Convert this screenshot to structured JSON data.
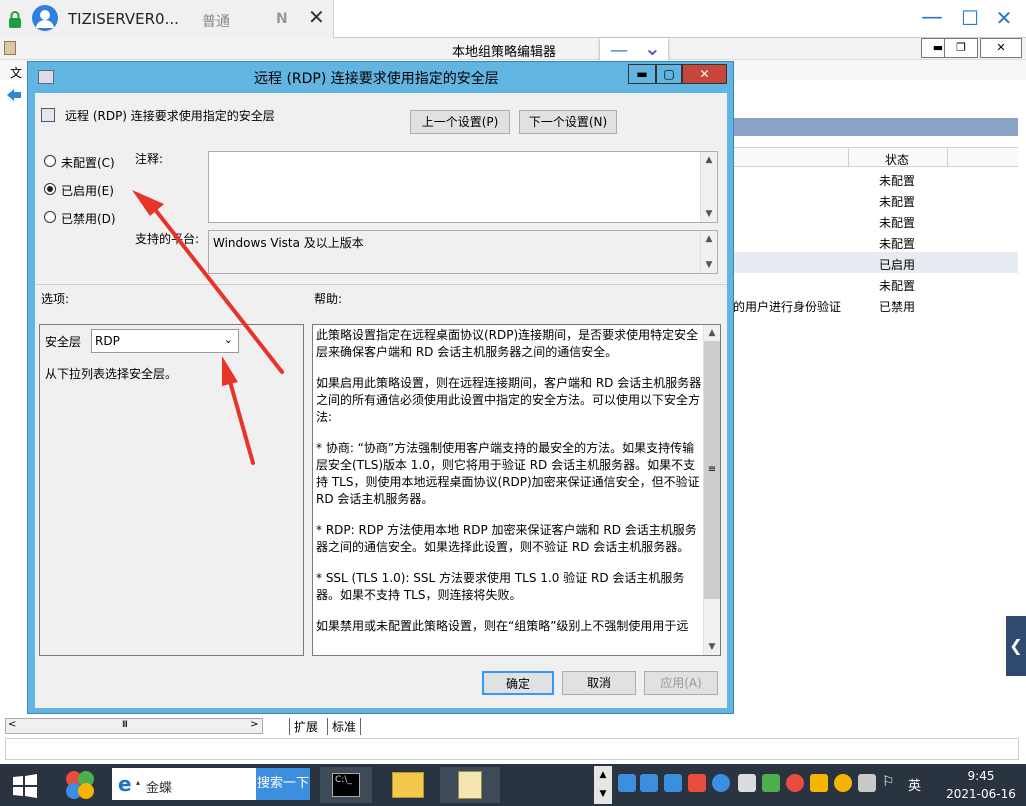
{
  "remote_bar": {
    "title": "TIZISERVER0...",
    "mode": "普通",
    "n_label": "N",
    "close": "✕",
    "minimize": "—",
    "maximize": "☐",
    "exit": "✕"
  },
  "host": {
    "title": "本地组策略编辑器",
    "menu_first": "文",
    "min": "▬",
    "restore": "❐",
    "close": "✕",
    "float_min": "—",
    "float_down": "⌄",
    "column_state": "状态",
    "rows": [
      {
        "desc": "",
        "state": "未配置"
      },
      {
        "desc": "",
        "state": "未配置"
      },
      {
        "desc": "",
        "state": "未配置"
      },
      {
        "desc": "",
        "state": "未配置"
      },
      {
        "desc": "",
        "state": "已启用"
      },
      {
        "desc": "",
        "state": "未配置"
      },
      {
        "desc": "的用户进行身份验证",
        "state": "已禁用"
      }
    ],
    "tabs": [
      "扩展",
      "标准"
    ],
    "scroll_thumb": "III"
  },
  "dialog": {
    "title": "远程 (RDP) 连接要求使用指定的安全层",
    "policy_name": "远程 (RDP) 连接要求使用指定的安全层",
    "prev_button": "上一个设置(P)",
    "next_button": "下一个设置(N)",
    "radios": [
      {
        "label": "未配置(C)",
        "checked": false
      },
      {
        "label": "已启用(E)",
        "checked": true
      },
      {
        "label": "已禁用(D)",
        "checked": false
      }
    ],
    "comment_label": "注释:",
    "comment_value": "",
    "supported_label": "支持的平台:",
    "supported_value": "Windows Vista 及以上版本",
    "options_label": "选项:",
    "help_label": "帮助:",
    "security_layer_label": "安全层",
    "security_layer_value": "RDP",
    "security_layer_hint": "从下拉列表选择安全层。",
    "help_paragraphs": [
      "此策略设置指定在远程桌面协议(RDP)连接期间，是否要求使用特定安全层来确保客户端和 RD 会话主机服务器之间的通信安全。",
      "如果启用此策略设置，则在远程连接期间，客户端和 RD 会话主机服务器之间的所有通信必须使用此设置中指定的安全方法。可以使用以下安全方法:",
      "* 协商: “协商”方法强制使用客户端支持的最安全的方法。如果支持传输层安全(TLS)版本 1.0，则它将用于验证 RD 会话主机服务器。如果不支持 TLS，则使用本地远程桌面协议(RDP)加密来保证通信安全，但不验证 RD 会话主机服务器。",
      "* RDP: RDP 方法使用本地 RDP 加密来保证客户端和 RD 会话主机服务器之间的通信安全。如果选择此设置，则不验证 RD 会话主机服务器。",
      "* SSL (TLS 1.0): SSL 方法要求使用 TLS 1.0 验证 RD 会话主机服务器。如果不支持 TLS，则连接将失败。",
      "如果禁用或未配置此策略设置，则在“组策略”级别上不强制使用用于远"
    ],
    "ok_button": "确定",
    "cancel_button": "取消",
    "apply_button": "应用(A)"
  },
  "taskbar": {
    "search_text": "金蝶",
    "search_button": "搜索一下",
    "ime": "英",
    "time": "9:45",
    "date": "2021-06-16"
  },
  "colors": {
    "dialog_frame": "#62b5e0",
    "annotation_arrow": "#e8332a",
    "accent": "#2b78d4"
  }
}
